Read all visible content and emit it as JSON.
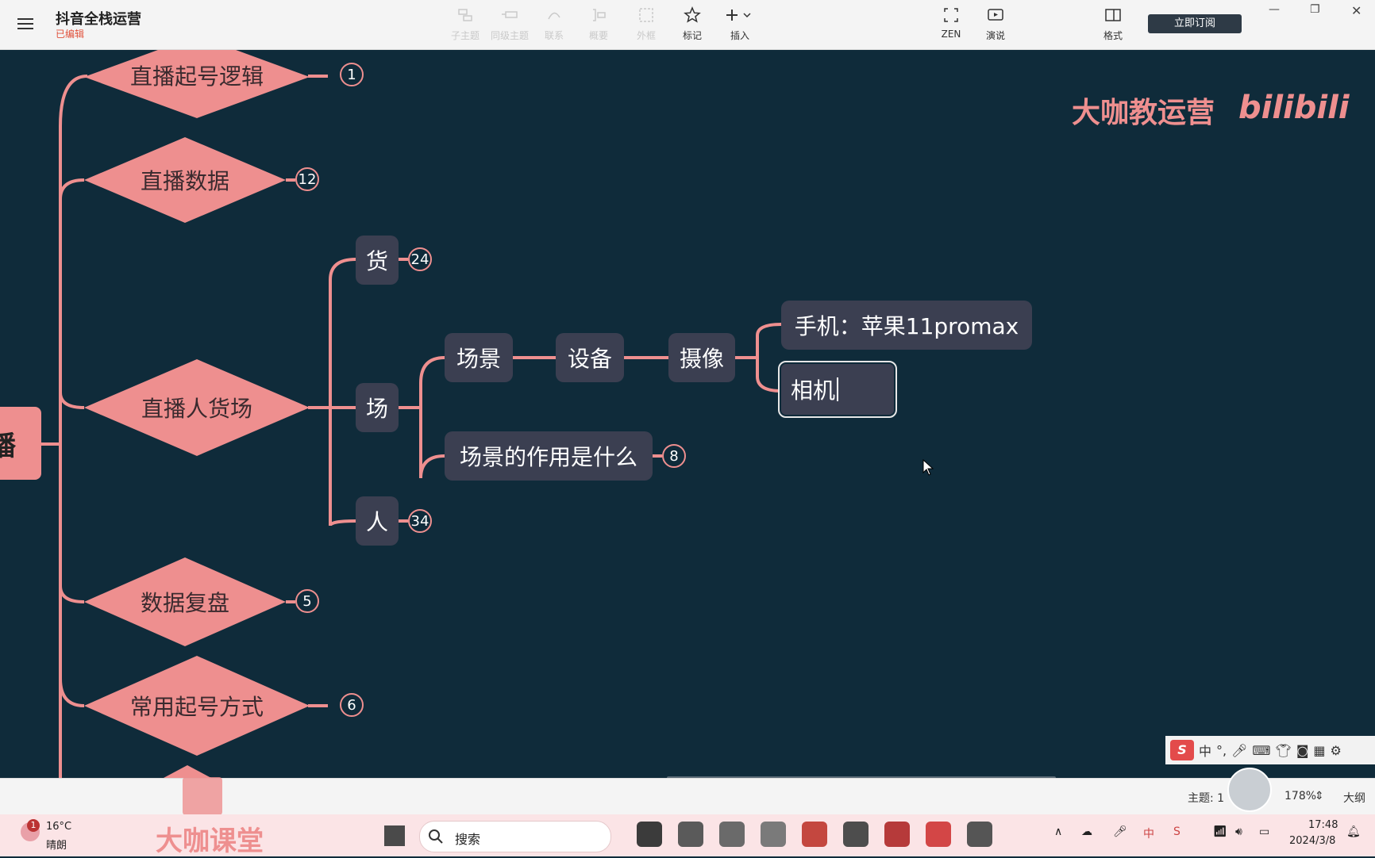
{
  "app": {
    "title": "抖音全栈运营",
    "status": "已编辑",
    "subscribe_label": "立即订阅"
  },
  "toolbar": {
    "items": [
      {
        "label": "子主题",
        "icon": "subtopic-icon",
        "enabled": false
      },
      {
        "label": "同级主题",
        "icon": "sibling-topic-icon",
        "enabled": false
      },
      {
        "label": "联系",
        "icon": "relationship-icon",
        "enabled": false
      },
      {
        "label": "概要",
        "icon": "summary-icon",
        "enabled": false
      },
      {
        "label": "外框",
        "icon": "boundary-icon",
        "enabled": false
      },
      {
        "label": "标记",
        "icon": "star-icon",
        "enabled": true
      },
      {
        "label": "插入",
        "icon": "plus-icon",
        "enabled": true
      }
    ],
    "zen_label": "ZEN",
    "present_label": "演说",
    "format_label": "格式"
  },
  "mindmap": {
    "root_fragment": "播",
    "branches": [
      {
        "label": "直播起号逻辑",
        "count": "1"
      },
      {
        "label": "直播数据",
        "count": "12"
      },
      {
        "label": "直播人货场",
        "count": ""
      },
      {
        "label": "数据复盘",
        "count": "5"
      },
      {
        "label": "常用起号方式",
        "count": "6"
      }
    ],
    "sub": {
      "huo": {
        "label": "货",
        "count": "24"
      },
      "chang": {
        "label": "场"
      },
      "ren": {
        "label": "人",
        "count": "34"
      },
      "changjing": {
        "label": "场景"
      },
      "shebei": {
        "label": "设备"
      },
      "shexiang": {
        "label": "摄像"
      },
      "phone": {
        "label": "手机：苹果11promax"
      },
      "camera": {
        "label": "相机"
      },
      "zuoyong": {
        "label": "场景的作用是什么",
        "count": "8"
      }
    }
  },
  "watermark": {
    "text": "大咖教运营",
    "logo": "bilibili"
  },
  "ime": {
    "lang": "中",
    "logo": "S"
  },
  "statusbar": {
    "topics": "主题: 1",
    "zoom": "178%",
    "outline_label": "大纲"
  },
  "taskbar": {
    "weather_temp": "16°C",
    "weather_desc": "晴朗",
    "weather_badge": "1",
    "brand": "大咖课堂",
    "search_placeholder": "搜索",
    "time": "17:48",
    "date": "2024/3/8",
    "ime_lang": "中"
  },
  "colors": {
    "canvas_bg": "#0f2b3a",
    "accent_pink": "#ee8f8f",
    "node_bg": "#3b3f51",
    "taskbar_bg": "#fbe4e6"
  }
}
